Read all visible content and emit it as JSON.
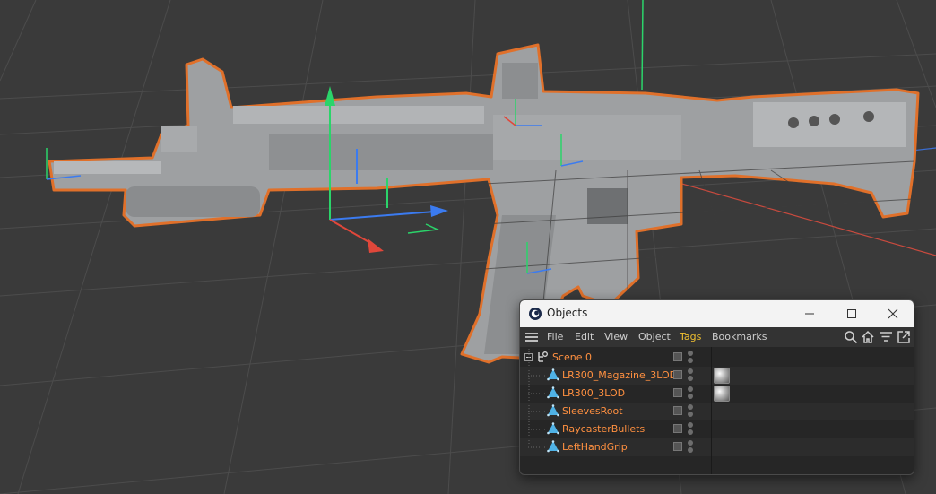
{
  "colors": {
    "viewport_bg": "#3a3a3a",
    "grid_line": "#4a4a4a",
    "model_gray": "#9ea0a2",
    "model_shadow": "#6e7072",
    "outline_orange": "#e0702a",
    "axis_x": "#e0473a",
    "axis_y": "#2bd46a",
    "axis_z": "#3b7bf0",
    "object_name": "#ff9040",
    "active_menu": "#f0c030"
  },
  "window": {
    "title": "Objects",
    "icon": "cinema4d-icon",
    "controls": [
      "minimize-icon",
      "maximize-icon",
      "close-icon"
    ]
  },
  "menu": {
    "items": [
      "File",
      "Edit",
      "View",
      "Object",
      "Tags",
      "Bookmarks"
    ],
    "active": "Tags",
    "tools": [
      "search-icon",
      "home-icon",
      "filter-icon",
      "new-window-icon"
    ]
  },
  "tree": {
    "scene": {
      "label": "Scene 0",
      "icon": "scene-icon"
    },
    "objects": [
      {
        "label": "LR300_Magazine_3LOD",
        "icon": "polygon-object-icon",
        "has_material": true
      },
      {
        "label": "LR300_3LOD",
        "icon": "polygon-object-icon",
        "has_material": true
      },
      {
        "label": "SleevesRoot",
        "icon": "polygon-object-icon",
        "has_material": false
      },
      {
        "label": "RaycasterBullets",
        "icon": "polygon-object-icon",
        "has_material": false
      },
      {
        "label": "LeftHandGrip",
        "icon": "polygon-object-icon",
        "has_material": false
      }
    ]
  }
}
